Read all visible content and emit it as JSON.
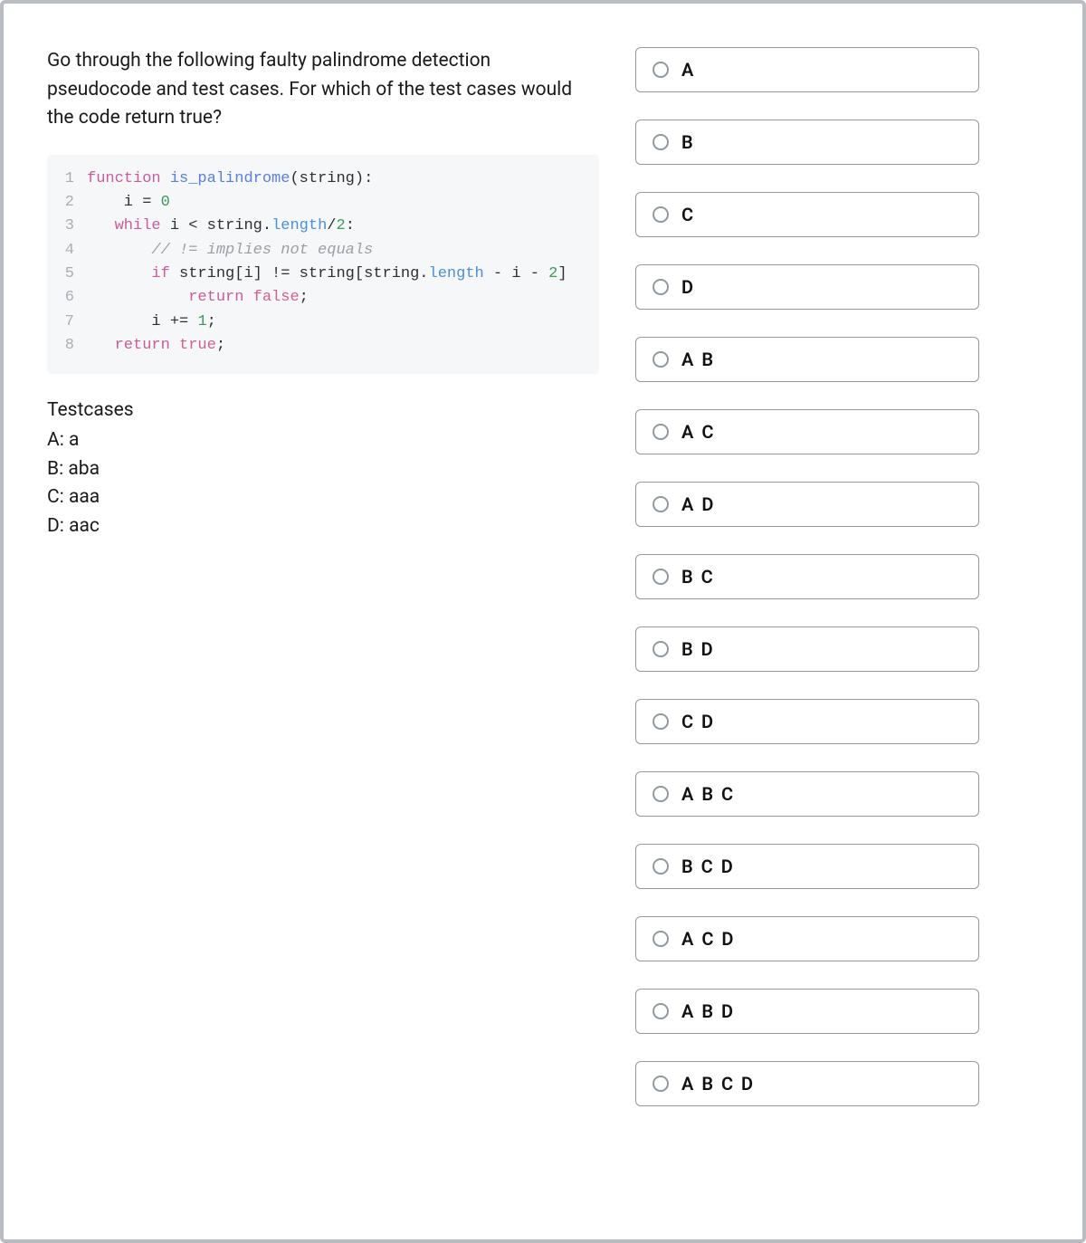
{
  "question": "Go through the following faulty palindrome detection pseudocode and test cases. For which of the test cases would the code return true?",
  "code": {
    "lines": [
      {
        "n": "1",
        "tokens": [
          {
            "t": "function",
            "c": "tok-kw"
          },
          {
            "t": " ",
            "c": ""
          },
          {
            "t": "is_palindrome",
            "c": "tok-fn"
          },
          {
            "t": "(",
            "c": "tok-par"
          },
          {
            "t": "string",
            "c": "tok-var"
          },
          {
            "t": "):",
            "c": "tok-par"
          }
        ]
      },
      {
        "n": "2",
        "tokens": [
          {
            "t": "    i ",
            "c": "tok-var"
          },
          {
            "t": "=",
            "c": "tok-op"
          },
          {
            "t": " ",
            "c": ""
          },
          {
            "t": "0",
            "c": "tok-num"
          }
        ]
      },
      {
        "n": "3",
        "tokens": [
          {
            "t": "   ",
            "c": ""
          },
          {
            "t": "while",
            "c": "tok-kw"
          },
          {
            "t": " i ",
            "c": "tok-var"
          },
          {
            "t": "<",
            "c": "tok-op"
          },
          {
            "t": " string.",
            "c": "tok-var"
          },
          {
            "t": "length",
            "c": "tok-prop"
          },
          {
            "t": "/",
            "c": "tok-op"
          },
          {
            "t": "2",
            "c": "tok-num"
          },
          {
            "t": ":",
            "c": "tok-par"
          }
        ]
      },
      {
        "n": "4",
        "tokens": [
          {
            "t": "       ",
            "c": ""
          },
          {
            "t": "// != implies not equals",
            "c": "tok-comment"
          }
        ]
      },
      {
        "n": "5",
        "tokens": [
          {
            "t": "       ",
            "c": ""
          },
          {
            "t": "if",
            "c": "tok-kw"
          },
          {
            "t": " string",
            "c": "tok-var"
          },
          {
            "t": "[",
            "c": "tok-par"
          },
          {
            "t": "i",
            "c": "tok-var"
          },
          {
            "t": "]",
            "c": "tok-par"
          },
          {
            "t": " != ",
            "c": "tok-op"
          },
          {
            "t": "string",
            "c": "tok-var"
          },
          {
            "t": "[",
            "c": "tok-par"
          },
          {
            "t": "string.",
            "c": "tok-var"
          },
          {
            "t": "length",
            "c": "tok-prop"
          },
          {
            "t": " - i - ",
            "c": "tok-op"
          },
          {
            "t": "2",
            "c": "tok-num"
          },
          {
            "t": "]",
            "c": "tok-par"
          }
        ]
      },
      {
        "n": "6",
        "tokens": [
          {
            "t": "           ",
            "c": ""
          },
          {
            "t": "return",
            "c": "tok-kw"
          },
          {
            "t": " ",
            "c": ""
          },
          {
            "t": "false",
            "c": "tok-bool"
          },
          {
            "t": ";",
            "c": "tok-par"
          }
        ]
      },
      {
        "n": "7",
        "tokens": [
          {
            "t": "       i ",
            "c": "tok-var"
          },
          {
            "t": "+=",
            "c": "tok-op"
          },
          {
            "t": " ",
            "c": ""
          },
          {
            "t": "1",
            "c": "tok-num"
          },
          {
            "t": ";",
            "c": "tok-par"
          }
        ]
      },
      {
        "n": "8",
        "tokens": [
          {
            "t": "   ",
            "c": ""
          },
          {
            "t": "return",
            "c": "tok-kw"
          },
          {
            "t": " ",
            "c": ""
          },
          {
            "t": "true",
            "c": "tok-bool"
          },
          {
            "t": ";",
            "c": "tok-par"
          }
        ]
      }
    ]
  },
  "testcases": {
    "title": "Testcases",
    "items": [
      "A: a",
      "B: aba",
      "C: aaa",
      "D: aac"
    ]
  },
  "options": [
    {
      "label": "A"
    },
    {
      "label": "B"
    },
    {
      "label": "C"
    },
    {
      "label": "D"
    },
    {
      "label": "A B"
    },
    {
      "label": "A C"
    },
    {
      "label": "A D"
    },
    {
      "label": "B C"
    },
    {
      "label": "B D"
    },
    {
      "label": "C D"
    },
    {
      "label": "A B C"
    },
    {
      "label": "B C D"
    },
    {
      "label": "A C D"
    },
    {
      "label": "A B D"
    },
    {
      "label": "A B C D"
    }
  ]
}
